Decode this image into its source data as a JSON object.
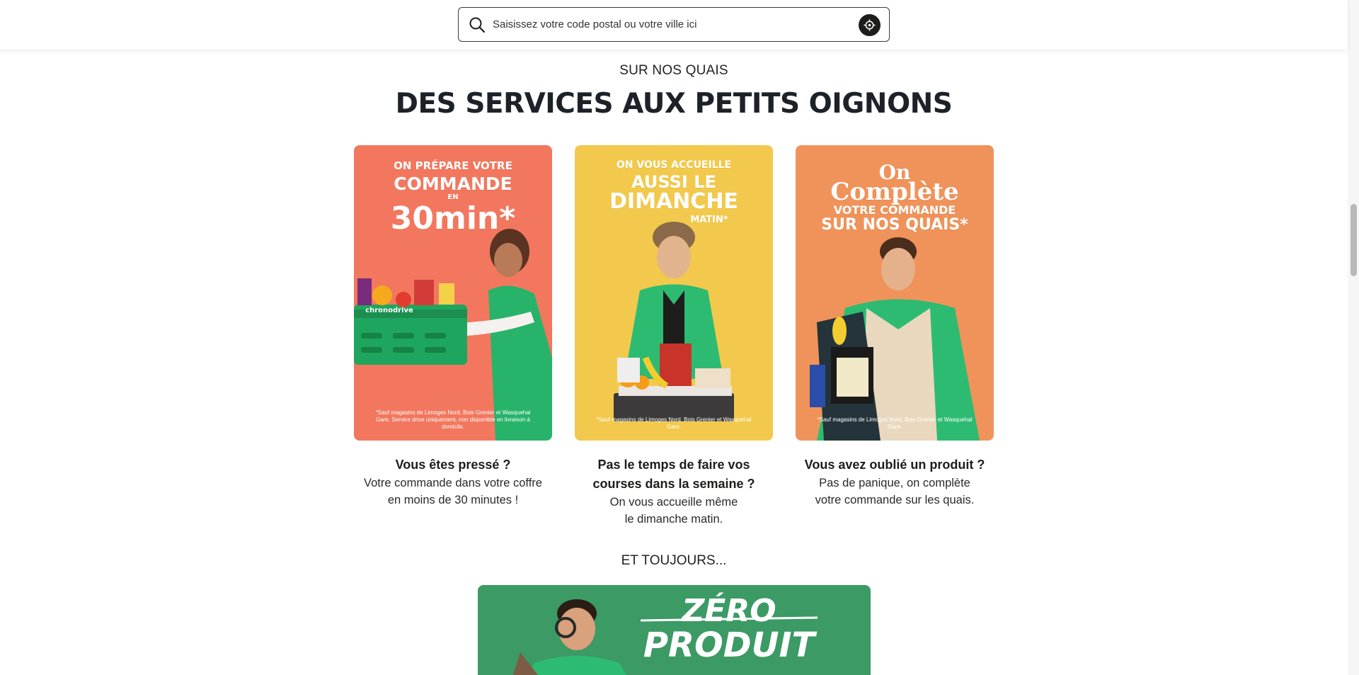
{
  "search": {
    "placeholder": "Saisissez votre code postal ou votre ville ici"
  },
  "section": {
    "eyebrow": "SUR NOS QUAIS",
    "title": "DES SERVICES AUX PETITS OIGNONS"
  },
  "cards": [
    {
      "poster_line1": "ON PRÉPARE VOTRE",
      "poster_line2": "COMMANDE",
      "poster_line3": "EN",
      "poster_line4": "30min*",
      "poster_brand": "chronodrive",
      "poster_fine": "*Sauf magasins de Limoges Nord, Bois Grenier et Wasquehal Gare. Service drive uniquement, non disponible en livraison à domicile.",
      "title": "Vous êtes pressé ?",
      "text": "Votre commande dans votre coffre en moins de 30 minutes !"
    },
    {
      "poster_line1": "ON VOUS ACCUEILLE",
      "poster_line2": "AUSSI LE",
      "poster_line3": "DIMANCHE",
      "poster_line4": "MATIN*",
      "poster_fine": "*Sauf magasins de Limoges Nord, Bois Grenier et Wasquehal Gare.",
      "title": "Pas le temps de faire vos courses dans la semaine ?",
      "text": "On vous accueille même le dimanche matin."
    },
    {
      "poster_line1": "On",
      "poster_line2": "Complète",
      "poster_line3": "VOTRE COMMANDE",
      "poster_line4": "SUR NOS QUAIS*",
      "poster_fine": "*Sauf magasins de Limoges Nord, Bois Grenier et Wasquehal Gare.",
      "title": "Vous avez oublié un produit ?",
      "text": "Pas de panique, on complète votre commande sur les quais."
    }
  ],
  "more": {
    "label": "ET TOUJOURS...",
    "banner_line1": "ZÉRO",
    "banner_line2": "PRODUIT"
  },
  "colors": {
    "card1_bg": "#f2775e",
    "card2_bg": "#f2c94c",
    "card3_bg": "#f0935a",
    "brand_green": "#27b36a",
    "banner_bg": "#3c9a65"
  },
  "icons": {
    "search": "search-icon",
    "locate": "location-target-icon"
  }
}
